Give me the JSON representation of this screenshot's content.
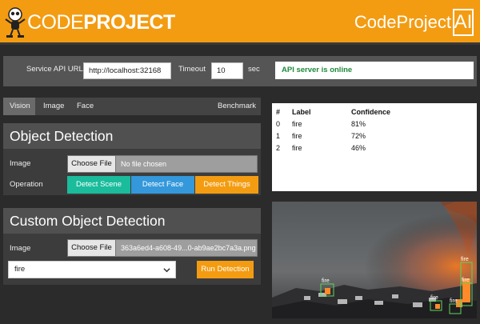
{
  "header": {
    "brand_light": "CODE",
    "brand_bold": "PROJECT",
    "right_text": "CodeProject",
    "right_badge": "AI",
    "color": "#f39c12"
  },
  "settings": {
    "api_url_label": "Service API URL",
    "api_url_value": "http://localhost:32168",
    "timeout_label": "Timeout",
    "timeout_value": "10",
    "timeout_unit": "sec",
    "status_text": "API server is online",
    "status_color": "#1e8a3a"
  },
  "tabs": [
    "Vision",
    "Image",
    "Face"
  ],
  "benchmark_tab": "Benchmark",
  "object_detection": {
    "title": "Object Detection",
    "image_label": "Image",
    "choose_file": "Choose File",
    "file_name": "No file chosen",
    "operation_label": "Operation",
    "buttons": [
      {
        "label": "Detect Scene",
        "color": "#1abc9c"
      },
      {
        "label": "Detect Face",
        "color": "#3498db"
      },
      {
        "label": "Detect Things",
        "color": "#f39c12"
      }
    ]
  },
  "custom_detection": {
    "title": "Custom Object Detection",
    "image_label": "Image",
    "choose_file": "Choose File",
    "file_name": "363a6ed4-a608-49...0-ab9ae2bc7a3a.png",
    "model_value": "fire",
    "run_button": "Run Detection"
  },
  "results": {
    "headers": [
      "#",
      "Label",
      "Confidence"
    ],
    "rows": [
      [
        "0",
        "fire",
        "81%"
      ],
      [
        "1",
        "fire",
        "72%"
      ],
      [
        "2",
        "fire",
        "46%"
      ]
    ]
  },
  "photo": {
    "detection_labels": [
      "fire",
      "fire",
      "fire",
      "fire",
      "fire"
    ]
  }
}
